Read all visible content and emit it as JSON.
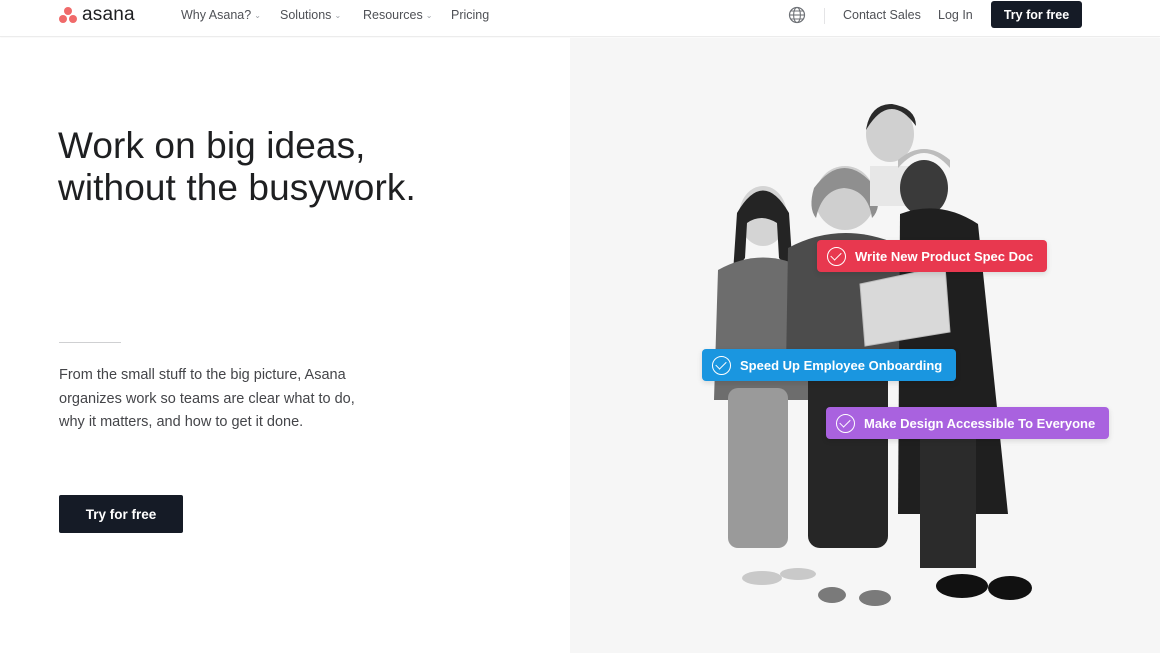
{
  "colors": {
    "brand_coral": "#f06a6a",
    "dark_cta": "#151b26",
    "pill_red": "#e8384f",
    "pill_blue": "#1a96e0",
    "pill_purple": "#a962df"
  },
  "nav": {
    "logo_text": "asana",
    "items": [
      {
        "label": "Why Asana?",
        "has_dropdown": true,
        "icon": "chevron-down-icon"
      },
      {
        "label": "Solutions",
        "has_dropdown": true,
        "icon": "chevron-down-icon"
      },
      {
        "label": "Resources",
        "has_dropdown": true,
        "icon": "chevron-down-icon"
      },
      {
        "label": "Pricing",
        "has_dropdown": false
      }
    ],
    "globe_icon": "globe-icon",
    "contact_sales": "Contact Sales",
    "log_in": "Log In",
    "cta": "Try for free"
  },
  "hero": {
    "headline_line1": "Work on big ideas,",
    "headline_line2": "without the busywork.",
    "subtext_line1": "From the small stuff to the big picture, Asana",
    "subtext_line2": "organizes work so teams are clear what to do,",
    "subtext_line3": "why it matters, and how to get it done.",
    "cta": "Try for free"
  },
  "task_pills": [
    {
      "label": "Write New Product Spec Doc",
      "color": "pill_red",
      "icon": "check-circle-icon"
    },
    {
      "label": "Speed Up Employee Onboarding",
      "color": "pill_blue",
      "icon": "check-circle-icon"
    },
    {
      "label": "Make Design Accessible To Everyone",
      "color": "pill_purple",
      "icon": "check-circle-icon"
    }
  ]
}
